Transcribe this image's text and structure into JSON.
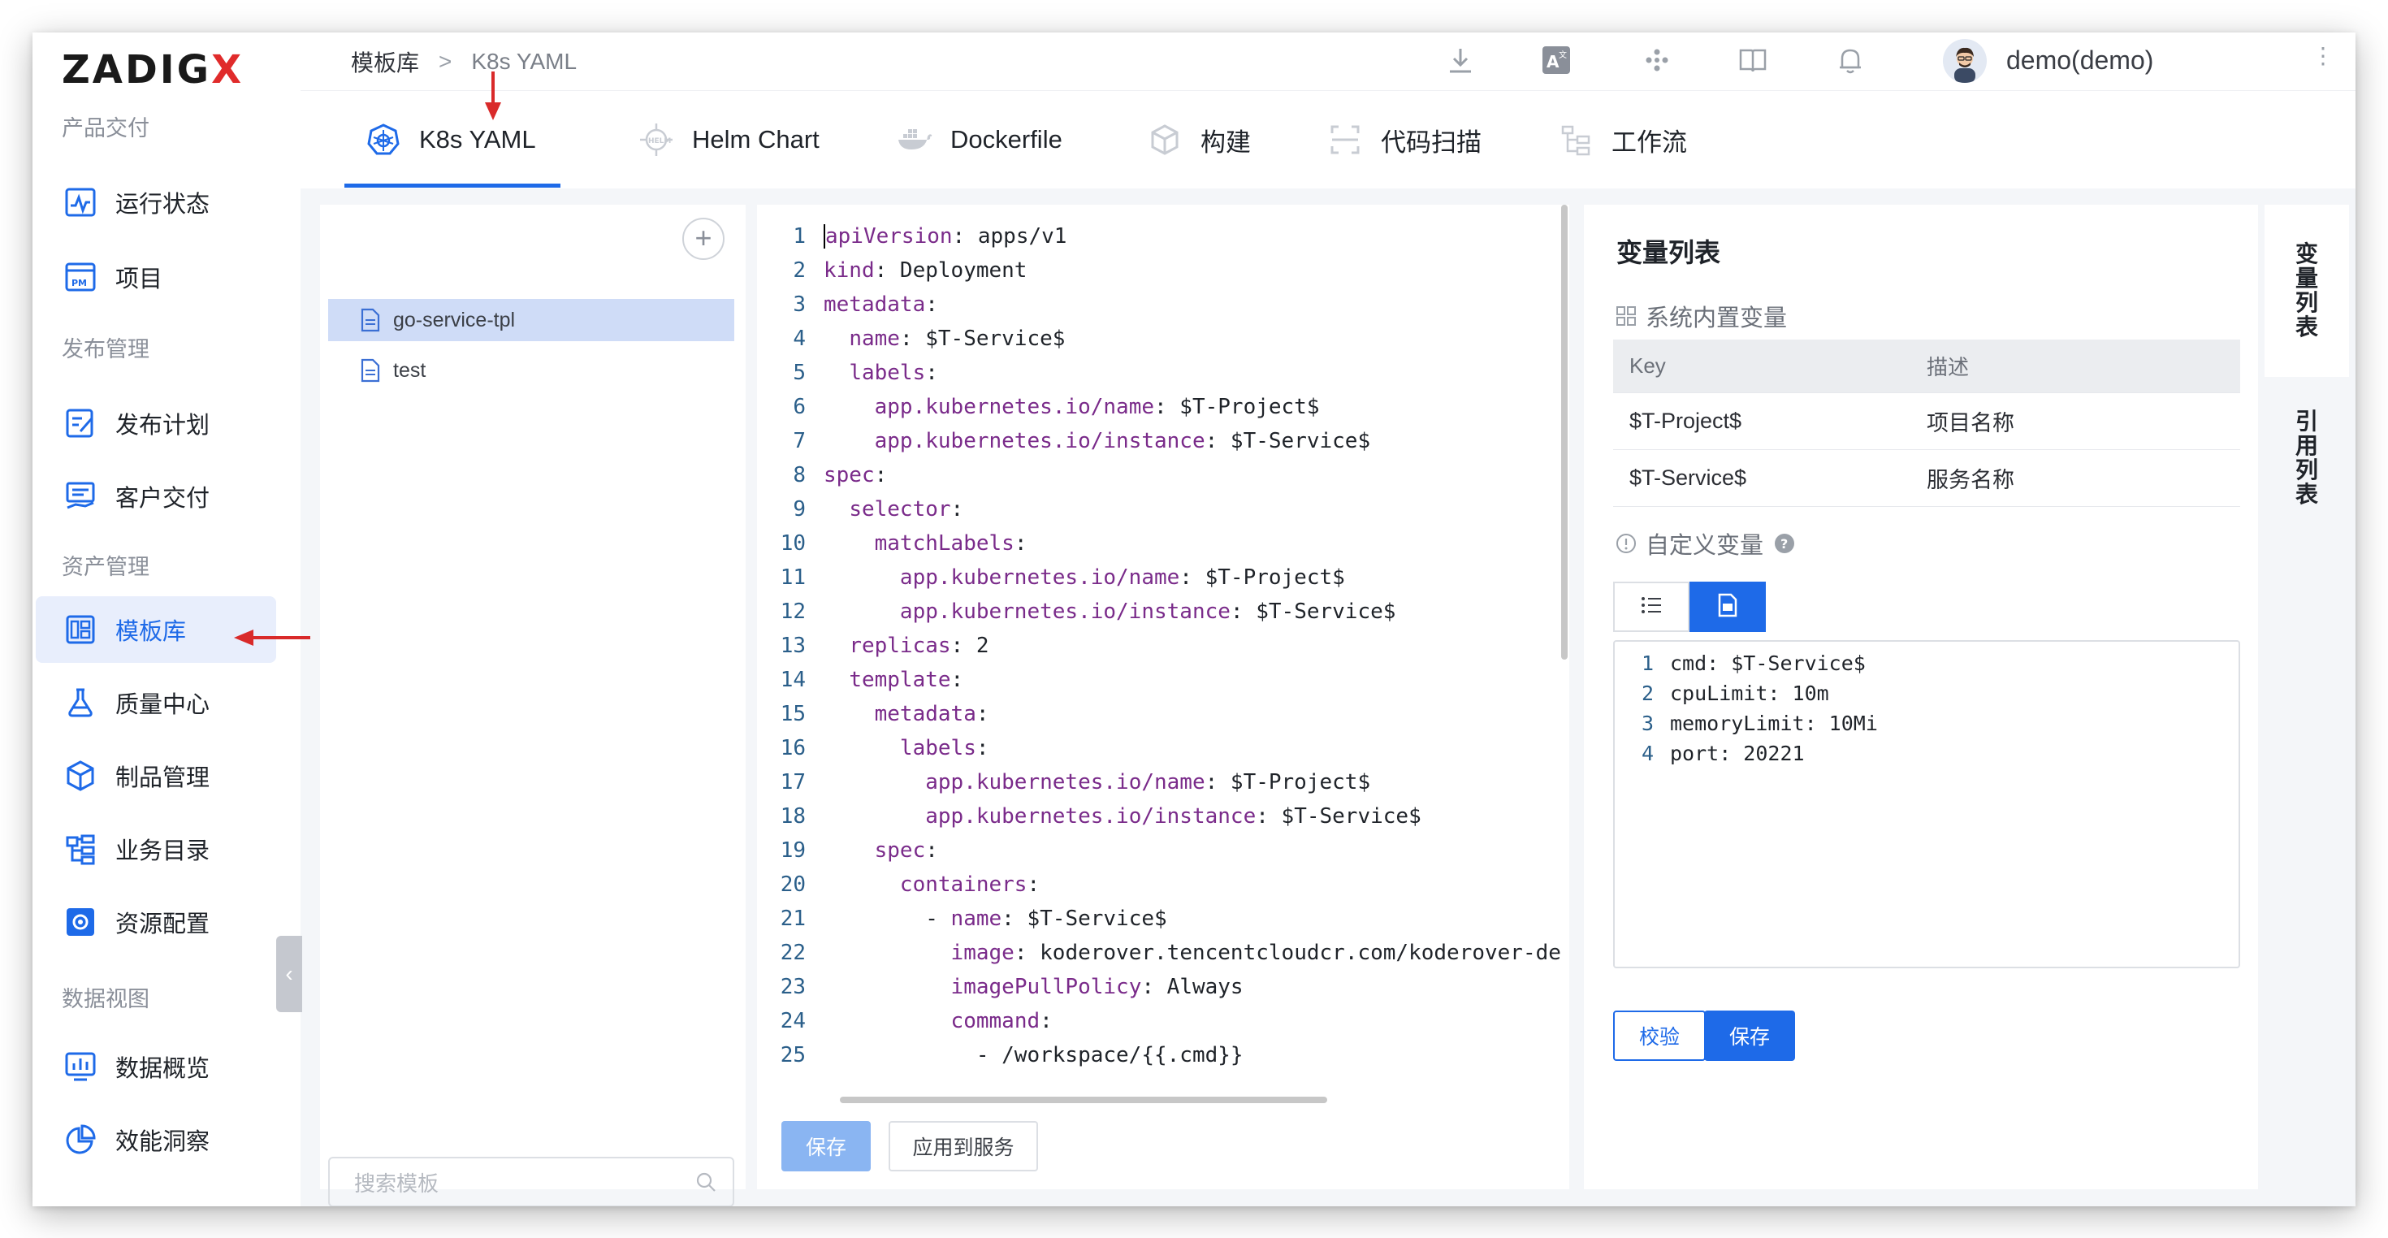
{
  "brand": {
    "logo_text": "ZADIG",
    "logo_accent": "X"
  },
  "sidebar": {
    "groups": [
      {
        "title": "产品交付"
      },
      {
        "title": "发布管理"
      },
      {
        "title": "资产管理"
      },
      {
        "title": "数据视图"
      }
    ],
    "items": [
      {
        "label": "运行状态",
        "icon": "pulse-chart-icon"
      },
      {
        "label": "项目",
        "icon": "pm-window-icon"
      },
      {
        "label": "发布计划",
        "icon": "plan-edit-icon"
      },
      {
        "label": "客户交付",
        "icon": "monitor-hand-icon"
      },
      {
        "label": "模板库",
        "icon": "template-icon",
        "active": true
      },
      {
        "label": "质量中心",
        "icon": "flask-icon"
      },
      {
        "label": "制品管理",
        "icon": "package-icon"
      },
      {
        "label": "业务目录",
        "icon": "catalog-icon"
      },
      {
        "label": "资源配置",
        "icon": "gear-box-icon"
      },
      {
        "label": "数据概览",
        "icon": "dashboard-icon"
      },
      {
        "label": "效能洞察",
        "icon": "pie-chart-icon"
      }
    ],
    "collapse_glyph": "‹"
  },
  "header": {
    "breadcrumb": [
      "模板库",
      ">",
      "K8s YAML"
    ],
    "username": "demo(demo)",
    "more": "⋮"
  },
  "tabs": [
    {
      "label": "K8s YAML",
      "icon": "kubernetes-icon",
      "active": true
    },
    {
      "label": "Helm Chart",
      "icon": "helm-icon"
    },
    {
      "label": "Dockerfile",
      "icon": "docker-icon"
    },
    {
      "label": "构建",
      "icon": "cube-icon"
    },
    {
      "label": "代码扫描",
      "icon": "scan-icon"
    },
    {
      "label": "工作流",
      "icon": "workflow-icon"
    }
  ],
  "files": {
    "add": "+",
    "items": [
      {
        "name": "go-service-tpl",
        "active": true
      },
      {
        "name": "test"
      }
    ],
    "search_placeholder": "搜索模板"
  },
  "editor": {
    "lines": [
      [
        [
          "k",
          "apiVersion"
        ],
        [
          "v",
          ": apps/v1"
        ]
      ],
      [
        [
          "k",
          "kind"
        ],
        [
          "v",
          ": Deployment"
        ]
      ],
      [
        [
          "k",
          "metadata"
        ],
        [
          "v",
          ":"
        ]
      ],
      [
        [
          "v",
          "  "
        ],
        [
          "k",
          "name"
        ],
        [
          "v",
          ": $T-Service$"
        ]
      ],
      [
        [
          "v",
          "  "
        ],
        [
          "k",
          "labels"
        ],
        [
          "v",
          ":"
        ]
      ],
      [
        [
          "v",
          "    "
        ],
        [
          "k",
          "app.kubernetes.io/name"
        ],
        [
          "v",
          ": $T-Project$"
        ]
      ],
      [
        [
          "v",
          "    "
        ],
        [
          "k",
          "app.kubernetes.io/instance"
        ],
        [
          "v",
          ": $T-Service$"
        ]
      ],
      [
        [
          "k",
          "spec"
        ],
        [
          "v",
          ":"
        ]
      ],
      [
        [
          "v",
          "  "
        ],
        [
          "k",
          "selector"
        ],
        [
          "v",
          ":"
        ]
      ],
      [
        [
          "v",
          "    "
        ],
        [
          "k",
          "matchLabels"
        ],
        [
          "v",
          ":"
        ]
      ],
      [
        [
          "v",
          "      "
        ],
        [
          "k",
          "app.kubernetes.io/name"
        ],
        [
          "v",
          ": $T-Project$"
        ]
      ],
      [
        [
          "v",
          "      "
        ],
        [
          "k",
          "app.kubernetes.io/instance"
        ],
        [
          "v",
          ": $T-Service$"
        ]
      ],
      [
        [
          "v",
          "  "
        ],
        [
          "k",
          "replicas"
        ],
        [
          "v",
          ": 2"
        ]
      ],
      [
        [
          "v",
          "  "
        ],
        [
          "k",
          "template"
        ],
        [
          "v",
          ":"
        ]
      ],
      [
        [
          "v",
          "    "
        ],
        [
          "k",
          "metadata"
        ],
        [
          "v",
          ":"
        ]
      ],
      [
        [
          "v",
          "      "
        ],
        [
          "k",
          "labels"
        ],
        [
          "v",
          ":"
        ]
      ],
      [
        [
          "v",
          "        "
        ],
        [
          "k",
          "app.kubernetes.io/name"
        ],
        [
          "v",
          ": $T-Project$"
        ]
      ],
      [
        [
          "v",
          "        "
        ],
        [
          "k",
          "app.kubernetes.io/instance"
        ],
        [
          "v",
          ": $T-Service$"
        ]
      ],
      [
        [
          "v",
          "    "
        ],
        [
          "k",
          "spec"
        ],
        [
          "v",
          ":"
        ]
      ],
      [
        [
          "v",
          "      "
        ],
        [
          "k",
          "containers"
        ],
        [
          "v",
          ":"
        ]
      ],
      [
        [
          "v",
          "        - "
        ],
        [
          "k",
          "name"
        ],
        [
          "v",
          ": $T-Service$"
        ]
      ],
      [
        [
          "v",
          "          "
        ],
        [
          "k",
          "image"
        ],
        [
          "v",
          ": koderover.tencentcloudcr.com/koderover-de"
        ]
      ],
      [
        [
          "v",
          "          "
        ],
        [
          "k",
          "imagePullPolicy"
        ],
        [
          "v",
          ": Always"
        ]
      ],
      [
        [
          "v",
          "          "
        ],
        [
          "k",
          "command"
        ],
        [
          "v",
          ":"
        ]
      ],
      [
        [
          "v",
          "            - /workspace/{{.cmd}}"
        ]
      ]
    ],
    "save_label": "保存",
    "apply_label": "应用到服务"
  },
  "variables": {
    "title": "变量列表",
    "system_section": "系统内置变量",
    "columns": [
      "Key",
      "描述"
    ],
    "rows": [
      [
        "$T-Project$",
        "项目名称"
      ],
      [
        "$T-Service$",
        "服务名称"
      ]
    ],
    "custom_section": "自定义变量",
    "custom_lines": [
      "cmd: $T-Service$",
      "cpuLimit: 10m",
      "memoryLimit: 10Mi",
      "port: 20221"
    ],
    "check_label": "校验",
    "save_label": "保存"
  },
  "side_tabs": [
    {
      "label": "变量列表",
      "active": true
    },
    {
      "label": "引用列表"
    }
  ],
  "colors": {
    "accent": "#1e6ae8",
    "annotation_red": "#d92a2a"
  }
}
